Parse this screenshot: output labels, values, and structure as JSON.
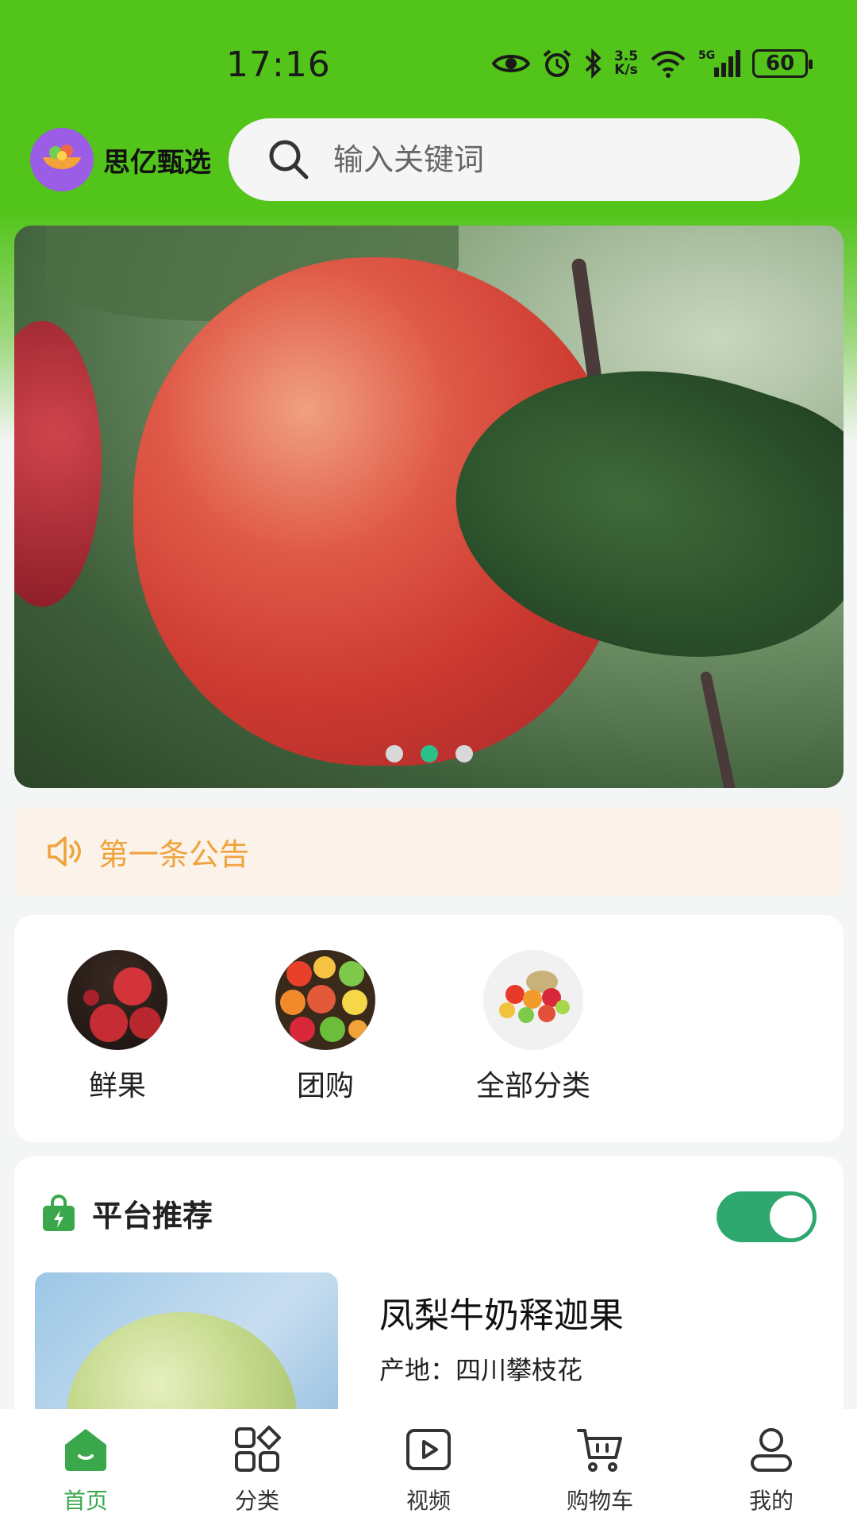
{
  "status_bar": {
    "time": "17:16",
    "net_speed_value": "3.5",
    "net_speed_unit": "K/s",
    "network": "5G",
    "battery": "60"
  },
  "header": {
    "brand_name": "思亿甄选",
    "search_placeholder": "输入关键词"
  },
  "banner": {
    "page_count": 3,
    "active_index": 1
  },
  "notice": {
    "text": "第一条公告"
  },
  "categories": [
    {
      "label": "鲜果",
      "icon": "apple-photo"
    },
    {
      "label": "团购",
      "icon": "fruit-mix-photo"
    },
    {
      "label": "全部分类",
      "icon": "fruit-basket-photo"
    }
  ],
  "recommend": {
    "title": "平台推荐",
    "toggle_on": true,
    "product": {
      "name": "凤梨牛奶释迦果",
      "origin": "产地：四川攀枝花"
    }
  },
  "tabbar": [
    {
      "label": "首页",
      "icon": "home-icon",
      "active": true
    },
    {
      "label": "分类",
      "icon": "category-icon",
      "active": false
    },
    {
      "label": "视频",
      "icon": "video-icon",
      "active": false
    },
    {
      "label": "购物车",
      "icon": "cart-icon",
      "active": false
    },
    {
      "label": "我的",
      "icon": "profile-icon",
      "active": false
    }
  ],
  "colors": {
    "header_green": "#52c41a",
    "accent_green": "#3aa84a",
    "toggle_green": "#2ea86e",
    "notice_orange": "#f0a23c",
    "dot_active": "#2cbf8a"
  }
}
